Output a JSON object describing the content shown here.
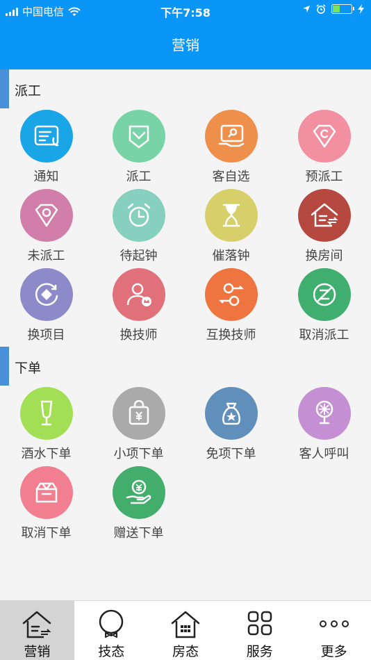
{
  "status_bar": {
    "carrier": "中国电信",
    "time": "下午7:58",
    "battery_percent": 40
  },
  "header": {
    "title": "营销"
  },
  "sections": [
    {
      "title": "派工",
      "items": [
        {
          "label": "通知",
          "icon": "notice-icon",
          "color": "#1aa6e6"
        },
        {
          "label": "派工",
          "icon": "dispatch-shield-icon",
          "color": "#78d4a6"
        },
        {
          "label": "客自选",
          "icon": "customer-choice-card-icon",
          "color": "#ee8f4c"
        },
        {
          "label": "预派工",
          "icon": "pre-dispatch-diamond-icon",
          "color": "#f28fa0"
        },
        {
          "label": "未派工",
          "icon": "undispatched-diamond-icon",
          "color": "#d17eaa"
        },
        {
          "label": "待起钟",
          "icon": "alarm-clock-icon",
          "color": "#87d0bd"
        },
        {
          "label": "催落钟",
          "icon": "hourglass-icon",
          "color": "#d7cf6a"
        },
        {
          "label": "换房间",
          "icon": "change-room-house-icon",
          "color": "#b5493f"
        },
        {
          "label": "换项目",
          "icon": "change-project-icon",
          "color": "#8c8ac8"
        },
        {
          "label": "换技师",
          "icon": "change-technician-icon",
          "color": "#e0707a"
        },
        {
          "label": "互换技师",
          "icon": "swap-technician-icon",
          "color": "#ee7440"
        },
        {
          "label": "取消派工",
          "icon": "cancel-dispatch-icon",
          "color": "#3fae6e"
        }
      ]
    },
    {
      "title": "下单",
      "items": [
        {
          "label": "酒水下单",
          "icon": "drink-glass-icon",
          "color": "#a3df55"
        },
        {
          "label": "小项下单",
          "icon": "shopping-bag-icon",
          "color": "#aaaaaa"
        },
        {
          "label": "免项下单",
          "icon": "money-bag-icon",
          "color": "#5f8fba"
        },
        {
          "label": "客人呼叫",
          "icon": "guest-call-lamp-icon",
          "color": "#c58fd4"
        },
        {
          "label": "取消下单",
          "icon": "cancel-order-box-icon",
          "color": "#f27f8f"
        },
        {
          "label": "赠送下单",
          "icon": "gift-order-hand-icon",
          "color": "#43ad6b"
        }
      ]
    }
  ],
  "tabbar": {
    "items": [
      {
        "label": "营销",
        "icon": "marketing-house-icon",
        "active": true
      },
      {
        "label": "技态",
        "icon": "technician-bowtie-icon",
        "active": false
      },
      {
        "label": "房态",
        "icon": "room-status-house-icon",
        "active": false
      },
      {
        "label": "服务",
        "icon": "service-grid-icon",
        "active": false
      },
      {
        "label": "更多",
        "icon": "more-dots-icon",
        "active": false
      }
    ]
  }
}
